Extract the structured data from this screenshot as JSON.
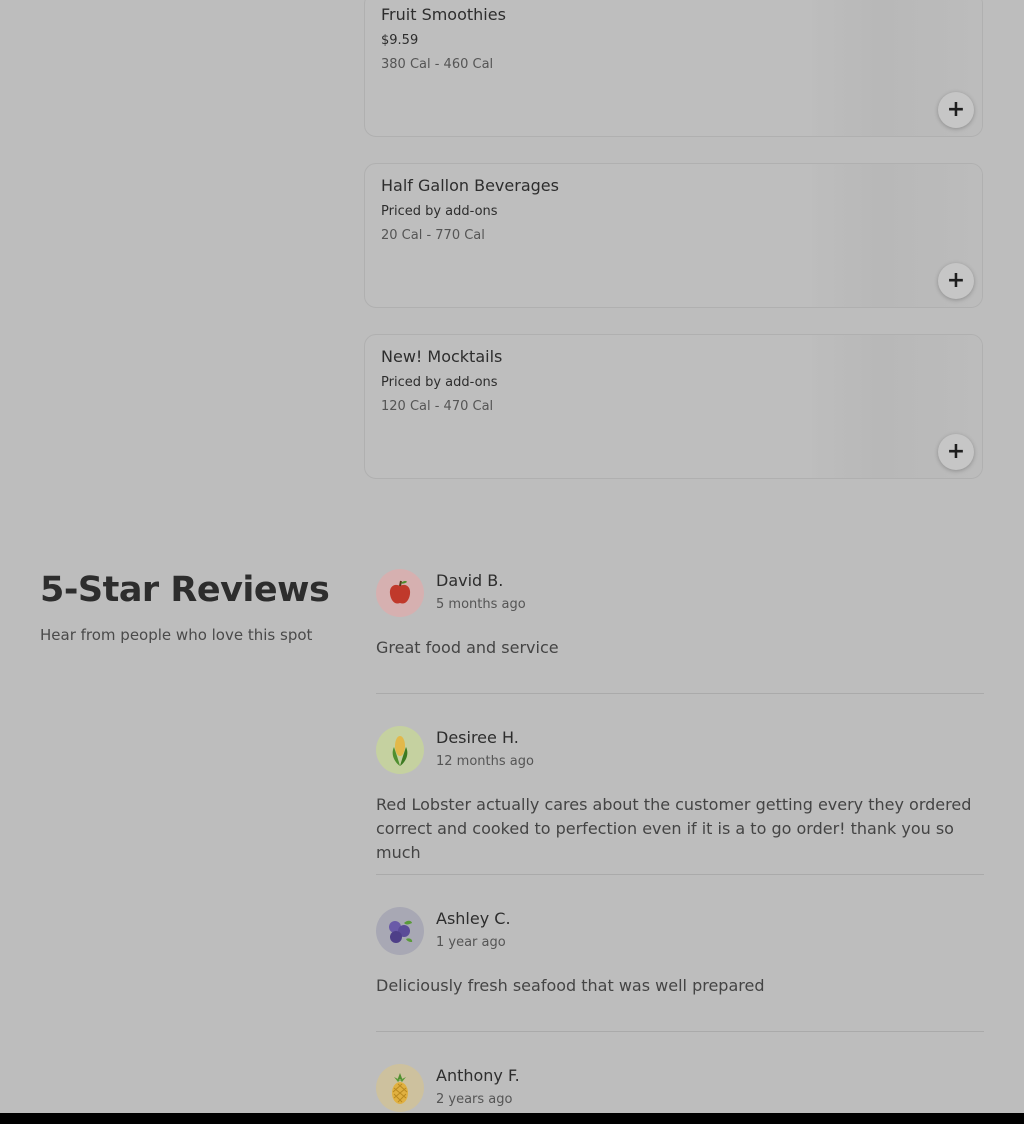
{
  "menu_items": [
    {
      "title": "Fruit Smoothies",
      "price": "$9.59",
      "calories": "380 Cal - 460 Cal",
      "add_label": "+"
    },
    {
      "title": "Half Gallon Beverages",
      "price": "Priced by add-ons",
      "calories": "20 Cal - 770 Cal",
      "add_label": "+"
    },
    {
      "title": "New! Mocktails",
      "price": "Priced by add-ons",
      "calories": "120 Cal - 470 Cal",
      "add_label": "+"
    }
  ],
  "reviews_section": {
    "heading": "5-Star Reviews",
    "subheading": "Hear from people who love this spot"
  },
  "reviews": [
    {
      "name": "David B.",
      "time": "5 months ago",
      "text": "Great food and service",
      "avatar_icon": "apple-icon",
      "avatar_bg": "#d9b3b3"
    },
    {
      "name": "Desiree H.",
      "time": "12 months ago",
      "text": "Red Lobster actually cares about the customer getting every they ordered correct and cooked to perfection even if it is a to go order! thank you so much",
      "avatar_icon": "corn-icon",
      "avatar_bg": "#c7d3a3"
    },
    {
      "name": "Ashley C.",
      "time": "1 year ago",
      "text": "Deliciously fresh seafood that was well prepared",
      "avatar_icon": "blueberry-icon",
      "avatar_bg": "#a9a9b6"
    },
    {
      "name": "Anthony F.",
      "time": "2 years ago",
      "text": "",
      "avatar_icon": "pineapple-icon",
      "avatar_bg": "#cfc3a0"
    }
  ]
}
